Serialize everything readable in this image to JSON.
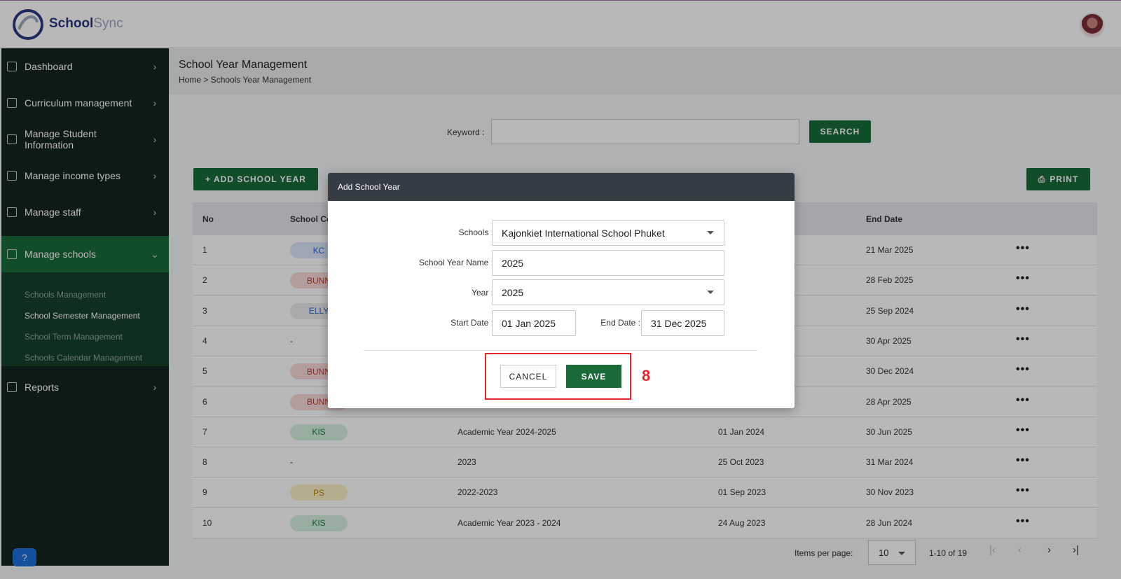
{
  "app": {
    "name_part1": "School",
    "name_part2": "Sync"
  },
  "sidebar": {
    "items": [
      {
        "label": "Dashboard",
        "icon": "grid-icon"
      },
      {
        "label": "Curriculum management",
        "icon": "graduation-cap-icon"
      },
      {
        "label": "Manage Student Information",
        "icon": "student-icon"
      },
      {
        "label": "Manage income types",
        "icon": "flask-icon"
      },
      {
        "label": "Manage staff",
        "icon": "staff-icon"
      },
      {
        "label": "Manage schools",
        "icon": "school-icon"
      },
      {
        "label": "Reports",
        "icon": "report-icon"
      }
    ],
    "sub_items": [
      "Schools Management",
      "School Semester Management",
      "School Term Management",
      "Schools Calendar Management"
    ]
  },
  "header": {
    "title": "School Year Management",
    "breadcrumb": "Home > Schools Year Management"
  },
  "search": {
    "label": "Keyword :",
    "button": "SEARCH"
  },
  "toolbar": {
    "add_label": "+ ADD SCHOOL YEAR",
    "print_label": "PRINT"
  },
  "table": {
    "headers": {
      "no": "No",
      "school_code": "School Co",
      "end_date": "End Date"
    },
    "rows": [
      {
        "no": "1",
        "code": "KC",
        "name": "",
        "start": "",
        "end": "21 Mar 2025"
      },
      {
        "no": "2",
        "code": "BUNN",
        "name": "",
        "start": "",
        "end": "28 Feb 2025"
      },
      {
        "no": "3",
        "code": "ELLY",
        "name": "",
        "start": "",
        "end": "25 Sep 2024"
      },
      {
        "no": "4",
        "code": "-",
        "name": "",
        "start": "",
        "end": "30 Apr 2025"
      },
      {
        "no": "5",
        "code": "BUNN",
        "name": "",
        "start": "",
        "end": "30 Dec 2024"
      },
      {
        "no": "6",
        "code": "BUNN",
        "name": "",
        "start": "",
        "end": "28 Apr 2025"
      },
      {
        "no": "7",
        "code": "KIS",
        "name": "Academic Year 2024-2025",
        "start": "01 Jan 2024",
        "end": "30 Jun 2025"
      },
      {
        "no": "8",
        "code": "-",
        "name": "2023",
        "start": "25 Oct 2023",
        "end": "31 Mar 2024"
      },
      {
        "no": "9",
        "code": "PS",
        "name": "2022-2023",
        "start": "01 Sep 2023",
        "end": "30 Nov 2023"
      },
      {
        "no": "10",
        "code": "KIS",
        "name": "Academic Year 2023 - 2024",
        "start": "24 Aug 2023",
        "end": "28 Jun 2024"
      }
    ]
  },
  "pager": {
    "label": "Items per page:",
    "size": "10",
    "range": "1-10 of 19"
  },
  "modal": {
    "title": "Add School Year",
    "schools_label": "Schools :",
    "schools_value": "Kajonkiet International School Phuket",
    "name_label": "School Year Name :",
    "name_value": "2025",
    "year_label": "Year :",
    "year_value": "2025",
    "start_label": "Start Date :",
    "start_value": "01 Jan 2025",
    "end_label": "End Date :",
    "end_value": "31 Dec 2025",
    "cancel": "CANCEL",
    "save": "SAVE"
  },
  "annotation": {
    "step": "8"
  },
  "colors": {
    "brand_green": "#1a6b39",
    "sidebar_bg": "#14241f",
    "modal_header": "#353c45",
    "annotation_red": "#e3252c"
  }
}
